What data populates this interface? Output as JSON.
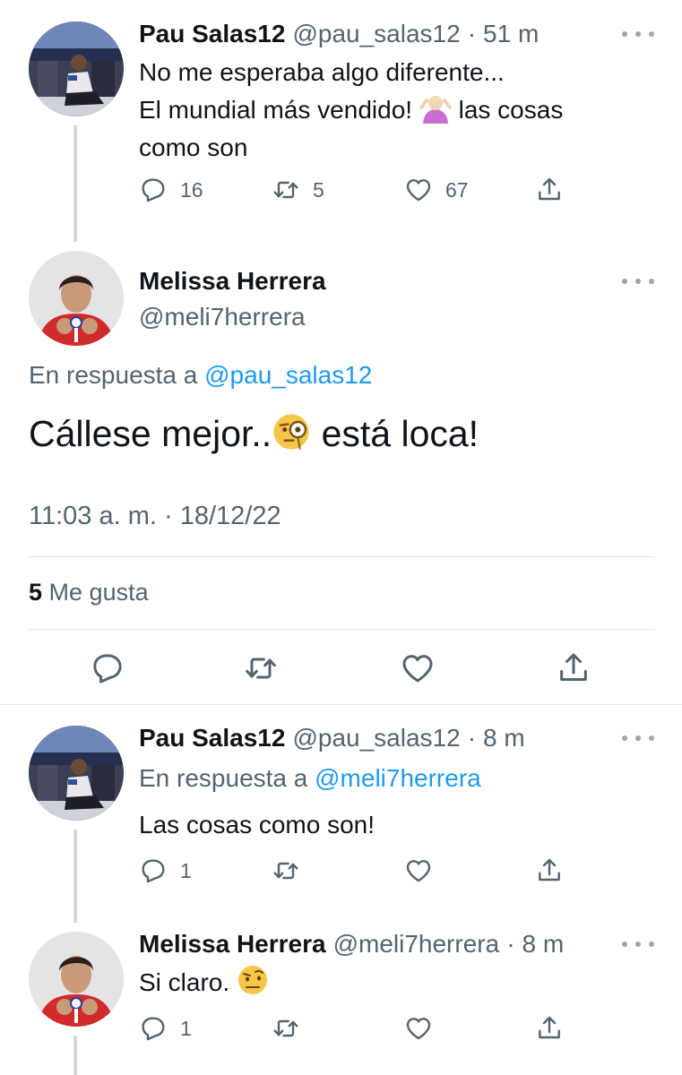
{
  "tweet1": {
    "name": "Pau Salas12",
    "handle": "@pau_salas12",
    "sep": "·",
    "time": "51 m",
    "lines": [
      "No me esperaba algo diferente...",
      "El mundial más vendido!",
      "las cosas",
      "como son"
    ],
    "replies": "16",
    "retweets": "5",
    "likes": "67"
  },
  "main": {
    "name": "Melissa Herrera",
    "handle": "@meli7herrera",
    "reply_prefix": "En respuesta a",
    "reply_to": "@pau_salas12",
    "text_before": "Cállese mejor..",
    "text_after": "está loca!",
    "timestamp": "11:03 a. m. · 18/12/22",
    "like_count": "5",
    "like_label": "Me gusta"
  },
  "tweet3": {
    "name": "Pau Salas12",
    "handle": "@pau_salas12",
    "sep": "·",
    "time": "8 m",
    "reply_prefix": "En respuesta a",
    "reply_to": "@meli7herrera",
    "text": "Las cosas como son!",
    "replies": "1"
  },
  "tweet4": {
    "name": "Melissa Herrera",
    "handle": "@meli7herrera",
    "sep": "·",
    "time": "8 m",
    "text": "Si claro.",
    "replies": "1"
  },
  "colors": {
    "text": "#0f1419",
    "secondary": "#536471",
    "link": "#1d9bf0",
    "divider": "#e1e6ea",
    "thread_line": "#cfd9de"
  },
  "icons": [
    "reply-icon",
    "retweet-icon",
    "like-icon",
    "share-icon",
    "more-icon",
    "shrug-emoji",
    "monocle-emoji",
    "raised-eyebrow-emoji"
  ]
}
